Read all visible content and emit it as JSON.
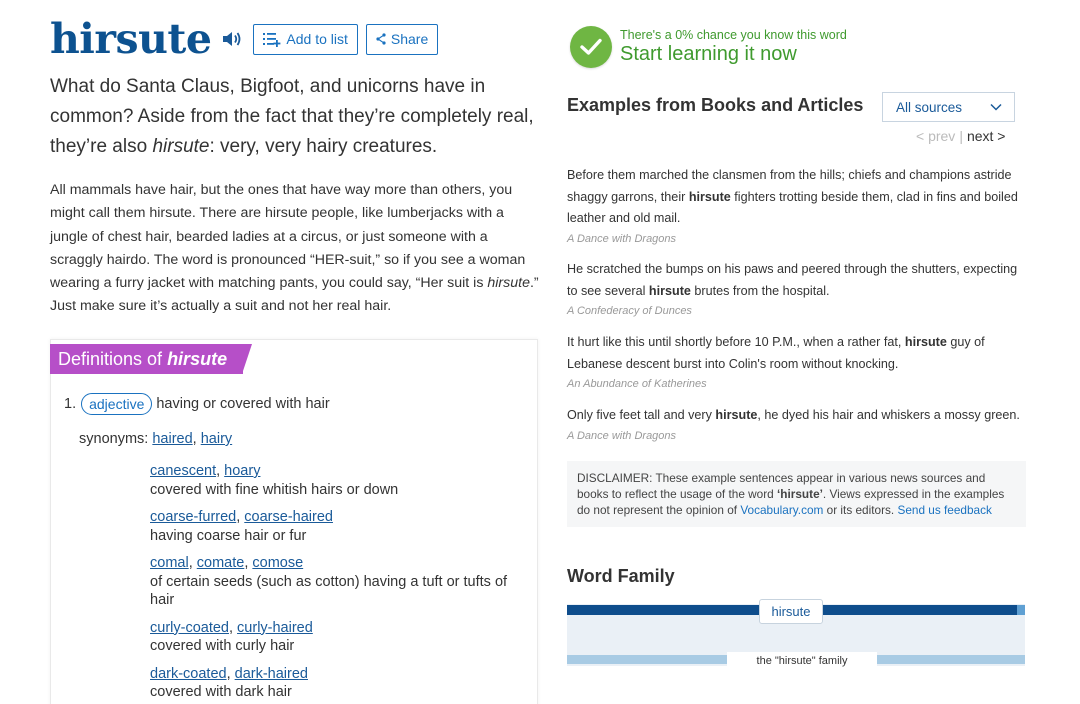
{
  "word": {
    "title": "hirsute",
    "add_to_list": "Add to list",
    "share": "Share"
  },
  "short_definition": {
    "line1": "What do Santa Claus, Bigfoot, and unicorns have in",
    "line2": "common? Aside from the fact that they’re completely real,",
    "line3_before": "they’re also ",
    "line3_word": "hirsute",
    "line3_after": ": very, very hairy creatures."
  },
  "long_definition": {
    "part1": "All mammals have hair, but the ones that have way more than others, you might call them hirsute. There are hirsute people, like lumberjacks with a jungle of chest hair, bearded ladies at a circus, or just someone with a scraggly hairdo. The word is pronounced “HER-suit,” so if you see a woman wearing a furry jacket with matching pants, you could say, “Her suit is ",
    "italic": "hirsute",
    "part2": ".” Just make sure it’s actually a suit and not her real hair."
  },
  "definitions": {
    "tab_prefix": "Definitions of",
    "tab_word": "hirsute",
    "sense_number": "1.",
    "pos": "adjective",
    "gloss": "having or covered with hair",
    "synonyms_label": "synonyms:",
    "synonyms": [
      "haired",
      "hairy"
    ],
    "groups": [
      {
        "words": [
          "canescent",
          "hoary"
        ],
        "gloss": "covered with fine whitish hairs or down"
      },
      {
        "words": [
          "coarse-furred",
          "coarse-haired"
        ],
        "gloss": "having coarse hair or fur"
      },
      {
        "words": [
          "comal",
          "comate",
          "comose"
        ],
        "gloss": "of certain seeds (such as cotton) having a tuft or tufts of hair"
      },
      {
        "words": [
          "curly-coated",
          "curly-haired"
        ],
        "gloss": "covered with curly hair"
      },
      {
        "words": [
          "dark-coated",
          "dark-haired"
        ],
        "gloss": "covered with dark hair"
      }
    ]
  },
  "learn": {
    "chance_text": "There's a 0% chance you know this word",
    "cta": "Start learning it now"
  },
  "examples": {
    "title": "Examples from Books and Articles",
    "source_filter": "All sources",
    "prev": "< prev",
    "pipe": "|",
    "next": "next >",
    "items": [
      {
        "before": "Before them marched the clansmen from the hills; chiefs and champions astride shaggy garrons, their ",
        "word": "hirsute",
        "after": " fighters trotting beside them, clad in fins and boiled leather and old mail.",
        "source": "A Dance with Dragons"
      },
      {
        "before": "He scratched the bumps on his paws and peered through the shutters, expecting to see several ",
        "word": "hirsute",
        "after": " brutes from the hospital.",
        "source": "A Confederacy of Dunces"
      },
      {
        "before": "It hurt like this until shortly before 10 P.M., when a rather fat, ",
        "word": "hirsute",
        "after": " guy of Lebanese descent burst into Colin's room without knocking.",
        "source": "An Abundance of Katherines"
      },
      {
        "before": "Only five feet tall and very ",
        "word": "hirsute",
        "after": ", he dyed his hair and whiskers a mossy green.",
        "source": "A Dance with Dragons"
      }
    ],
    "disclaimer": {
      "text1": "DISCLAIMER: These example sentences appear in various news sources and books to reflect the usage of the word ",
      "word": "‘hirsute’",
      "text2": ". Views expressed in the examples do not represent the opinion of ",
      "site": "Vocabulary.com",
      "text3": " or its editors. ",
      "feedback": "Send us feedback"
    }
  },
  "word_family": {
    "title": "Word Family",
    "node": "hirsute",
    "family_label": "the \"hirsute\" family"
  },
  "colors": {
    "title_blue": "#0d5290",
    "link_blue": "#1a72c0",
    "tab_purple": "#b64fc8",
    "learn_green": "#3f9a2e",
    "check_green": "#6fb643"
  }
}
